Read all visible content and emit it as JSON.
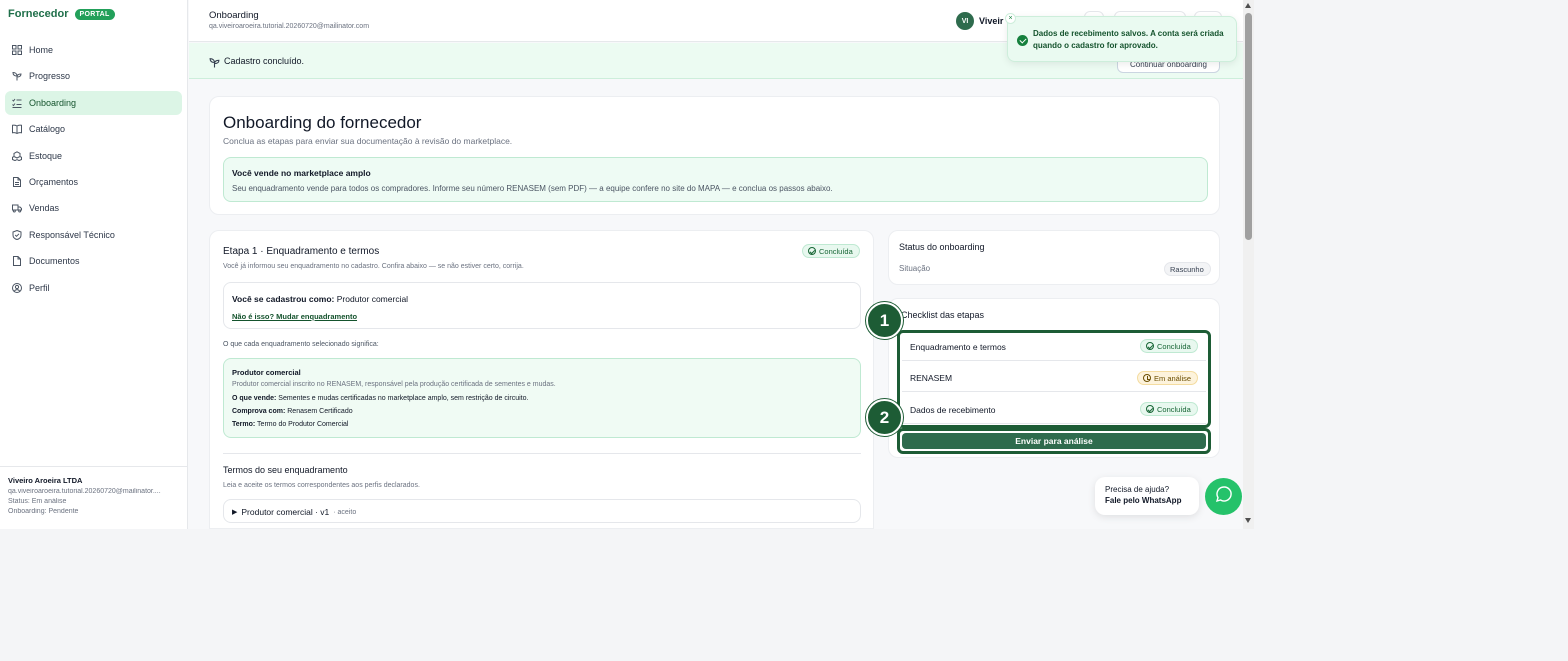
{
  "brand": {
    "name": "Fornecedor",
    "badge": "PORTAL"
  },
  "sidebar": {
    "items": [
      {
        "label": "Home",
        "icon": "grid-icon"
      },
      {
        "label": "Progresso",
        "icon": "sprout-icon"
      },
      {
        "label": "Onboarding",
        "icon": "list-check-icon",
        "active": true
      },
      {
        "label": "Catálogo",
        "icon": "book-icon"
      },
      {
        "label": "Estoque",
        "icon": "boxes-icon"
      },
      {
        "label": "Orçamentos",
        "icon": "file-icon"
      },
      {
        "label": "Vendas",
        "icon": "truck-icon"
      },
      {
        "label": "Responsável Técnico",
        "icon": "shield-check-icon"
      },
      {
        "label": "Documentos",
        "icon": "document-icon"
      },
      {
        "label": "Perfil",
        "icon": "user-circle-icon"
      }
    ],
    "footer": {
      "company": "Viveiro Aroeira LTDA",
      "email": "qa.viveiroaroeira.tutorial.20260720@mailinator....",
      "status": "Status: Em análise",
      "onboarding": "Onboarding: Pendente"
    }
  },
  "topbar": {
    "title": "Onboarding",
    "email": "qa.viveiroaroeira.tutorial.20260720@mailinator.com",
    "avatar": "VI",
    "user": "Viveir"
  },
  "banner": {
    "text": "Cadastro concluído.",
    "button": "Continuar onboarding"
  },
  "toast": {
    "message": "Dados de recebimento salvos. A conta será criada quando o cadastro for aprovado.",
    "close": "×"
  },
  "intro": {
    "title": "Onboarding do fornecedor",
    "subtitle": "Conclua as etapas para enviar sua documentação à revisão do marketplace.",
    "box_title": "Você vende no marketplace amplo",
    "box_text": "Seu enquadramento vende para todos os compradores. Informe seu número RENASEM (sem PDF) — a equipe confere no site do MAPA — e conclua os passos abaixo."
  },
  "step1": {
    "title": "Etapa 1 · Enquadramento e termos",
    "badge": "Concluída",
    "subtitle": "Você já informou seu enquadramento no cadastro. Confira abaixo — se não estiver certo, corrija.",
    "registered_label": "Você se cadastrou como:",
    "registered_value": "Produtor comercial",
    "change_link": "Não é isso? Mudar enquadramento",
    "means_label": "O que cada enquadramento selecionado significa:",
    "means": {
      "title": "Produtor comercial",
      "desc": "Produtor comercial inscrito no RENASEM, responsável pela produção certificada de sementes e mudas.",
      "sells_label": "O que vende:",
      "sells_value": "Sementes e mudas certificadas no marketplace amplo, sem restrição de circuito.",
      "proves_label": "Comprova com:",
      "proves_value": "Renasem Certificado",
      "term_label": "Termo:",
      "term_value": "Termo do Produtor Comercial"
    },
    "terms_title": "Termos do seu enquadramento",
    "terms_sub": "Leia e aceite os termos correspondentes aos perfis declarados.",
    "terms_item": "Produtor comercial · v1",
    "terms_item_status": "· aceito",
    "terms_tri": "▶"
  },
  "status": {
    "title": "Status do onboarding",
    "label": "Situação",
    "value": "Rascunho"
  },
  "checklist": {
    "title": "Checklist das etapas",
    "items": [
      {
        "label": "Enquadramento e termos",
        "status": "Concluída"
      },
      {
        "label": "RENASEM",
        "status": "Em análise"
      },
      {
        "label": "Dados de recebimento",
        "status": "Concluída"
      }
    ],
    "submit": "Enviar para análise"
  },
  "markers": [
    "1",
    "2"
  ],
  "help": {
    "line1": "Precisa de ajuda?",
    "line2": "Fale pelo WhatsApp"
  }
}
